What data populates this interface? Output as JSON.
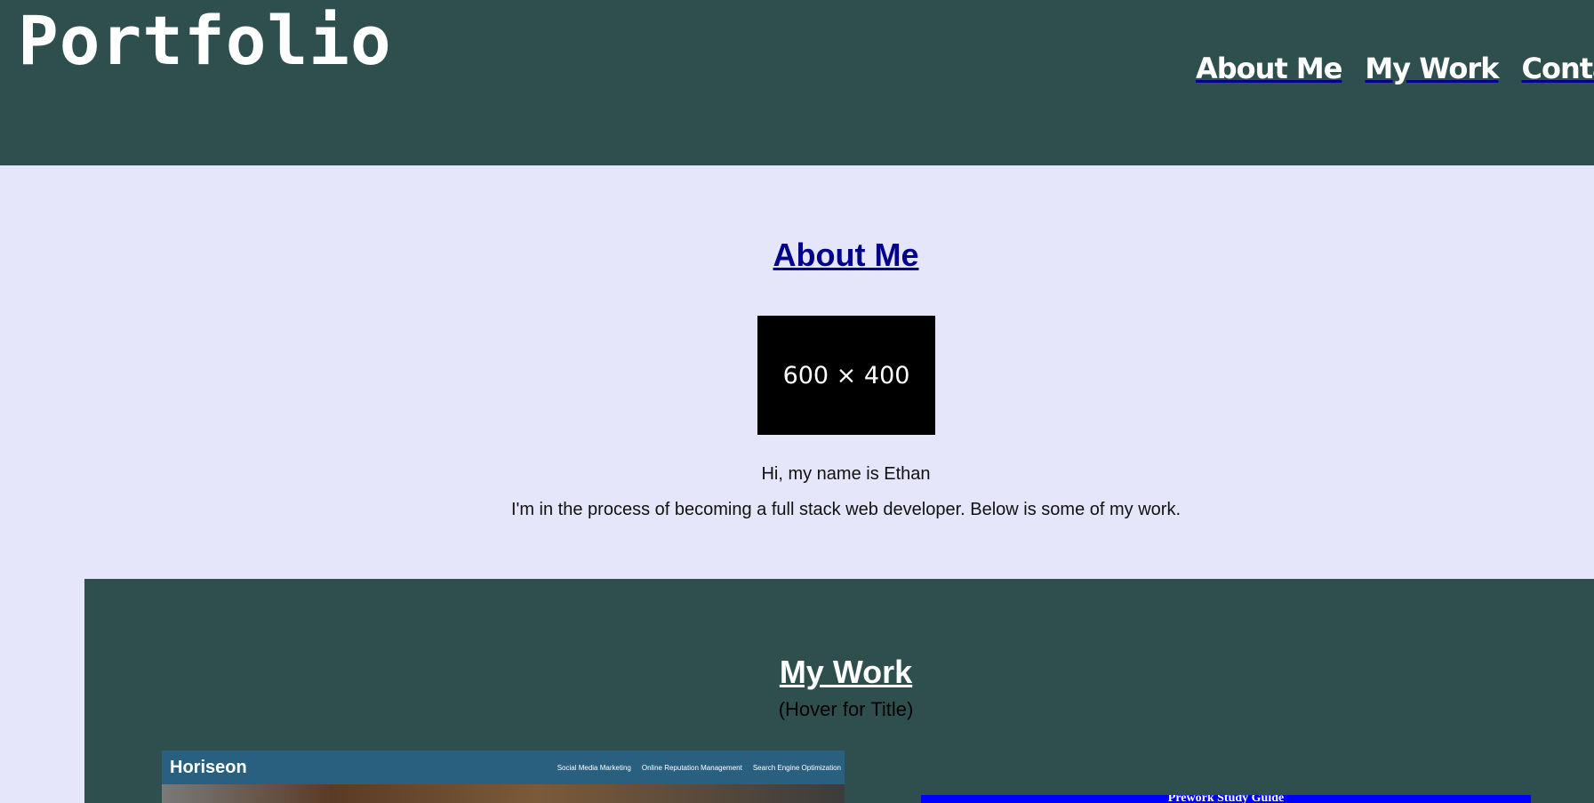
{
  "header": {
    "title": "Portfolio",
    "nav": [
      "About Me",
      "My Work",
      "Contact"
    ]
  },
  "about": {
    "heading": "About Me",
    "image_text": "600 × 400",
    "greeting": "Hi, my name is Ethan",
    "bio": "I'm in the process of becoming a full stack web developer. Below is some of my work."
  },
  "work": {
    "heading": "My Work",
    "hover_note": "(Hover for Title)",
    "project1": {
      "brand": "Horiseon",
      "links": [
        "Social Media Marketing",
        "Online Reputation Management",
        "Search Engine Optimization"
      ]
    },
    "project2": {
      "title": "Prework Study Guide"
    }
  },
  "colors": {
    "header_bg": "#2f4f4f",
    "page_bg": "#e6e6fa",
    "heading_link": "#00008b"
  }
}
